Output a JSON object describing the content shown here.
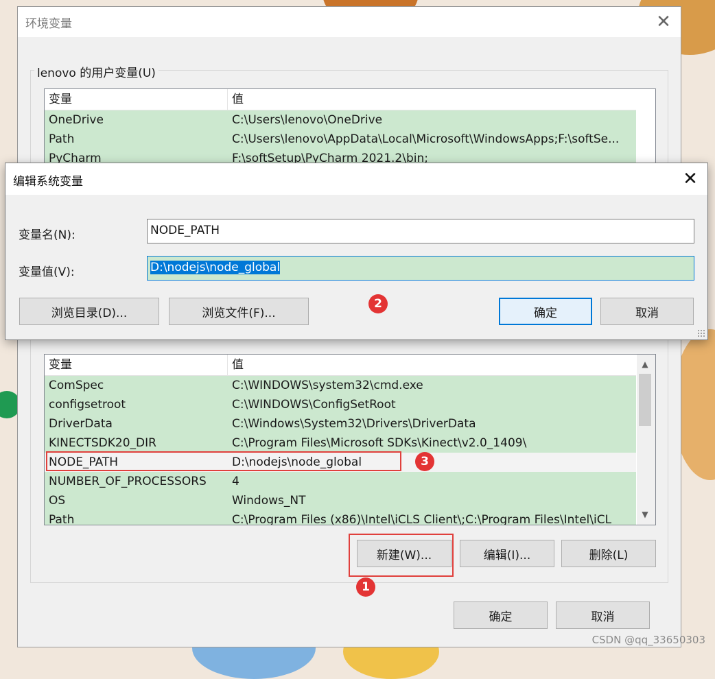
{
  "main_window": {
    "title": "环境变量",
    "user_group": {
      "legend": "lenovo 的用户变量(U)"
    },
    "user_list": {
      "headers": [
        "变量",
        "值"
      ],
      "rows": [
        {
          "name": "OneDrive",
          "value": "C:\\Users\\lenovo\\OneDrive"
        },
        {
          "name": "Path",
          "value": "C:\\Users\\lenovo\\AppData\\Local\\Microsoft\\WindowsApps;F:\\softSe..."
        },
        {
          "name": "PyCharm",
          "value": "F:\\softSetup\\PyCharm 2021.2\\bin;"
        }
      ]
    },
    "system_list": {
      "headers": [
        "变量",
        "值"
      ],
      "rows": [
        {
          "name": "ComSpec",
          "value": "C:\\WINDOWS\\system32\\cmd.exe"
        },
        {
          "name": "configsetroot",
          "value": "C:\\WINDOWS\\ConfigSetRoot"
        },
        {
          "name": "DriverData",
          "value": "C:\\Windows\\System32\\Drivers\\DriverData"
        },
        {
          "name": "KINECTSDK20_DIR",
          "value": "C:\\Program Files\\Microsoft SDKs\\Kinect\\v2.0_1409\\"
        },
        {
          "name": "NODE_PATH",
          "value": "D:\\nodejs\\node_global"
        },
        {
          "name": "NUMBER_OF_PROCESSORS",
          "value": "4"
        },
        {
          "name": "OS",
          "value": "Windows_NT"
        },
        {
          "name": "Path",
          "value": "C:\\Program Files (x86)\\Intel\\iCLS Client\\;C:\\Program Files\\Intel\\iCL"
        }
      ]
    },
    "system_buttons": {
      "new": "新建(W)...",
      "edit": "编辑(I)...",
      "delete": "删除(L)"
    },
    "footer_buttons": {
      "ok": "确定",
      "cancel": "取消"
    }
  },
  "edit_dialog": {
    "title": "编辑系统变量",
    "name_label": "变量名(N):",
    "name_value": "NODE_PATH",
    "value_label": "变量值(V):",
    "value_value": "D:\\nodejs\\node_global",
    "buttons": {
      "browse_dir": "浏览目录(D)...",
      "browse_file": "浏览文件(F)...",
      "ok": "确定",
      "cancel": "取消"
    }
  },
  "annotations": {
    "badge_1": "1",
    "badge_2": "2",
    "badge_3": "3"
  },
  "watermark": "CSDN @qq_33650303",
  "colors": {
    "selection": "#cce8cf",
    "accent": "#0078d7",
    "annotation": "#e33434"
  }
}
